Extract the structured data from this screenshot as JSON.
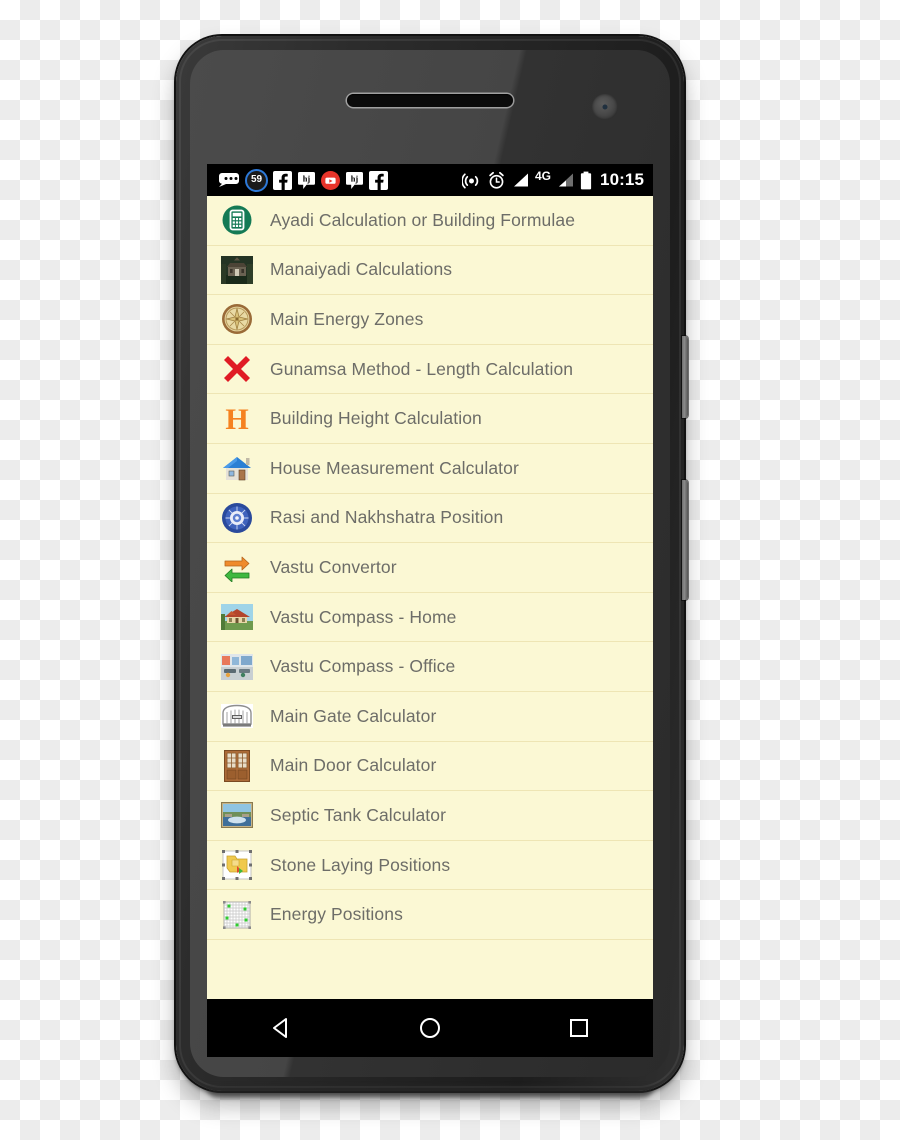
{
  "device": {
    "name": "android-smartphone",
    "earpiece": "earpiece-speaker-grille",
    "bottom_speaker": "bottom-speaker-grille",
    "front_camera": "front-camera",
    "buttons": [
      "volume-rocker",
      "power-button"
    ]
  },
  "status_bar": {
    "background": "#000000",
    "time": "10:15",
    "notification_badge": "59",
    "left_icons": [
      {
        "name": "messages-icon",
        "label": "Messages"
      },
      {
        "name": "notification-count-badge",
        "label": "59"
      },
      {
        "name": "facebook-icon",
        "label": "Facebook"
      },
      {
        "name": "hike-icon",
        "label": "Hike"
      },
      {
        "name": "youtube-icon",
        "label": "YouTube"
      },
      {
        "name": "hike-icon-2",
        "label": "Hike"
      },
      {
        "name": "facebook-icon-2",
        "label": "Facebook"
      }
    ],
    "right_icons": [
      {
        "name": "hotspot-icon",
        "label": "Hotspot"
      },
      {
        "name": "alarm-icon",
        "label": "Alarm"
      },
      {
        "name": "signal-bars-icon",
        "label": "Signal SIM 1"
      },
      {
        "name": "network-type-label",
        "label": "4G"
      },
      {
        "name": "signal-bars-icon-2",
        "label": "Signal SIM 2"
      },
      {
        "name": "battery-icon",
        "label": "Battery"
      }
    ]
  },
  "screen": {
    "background": "#fbf8d4",
    "text_color": "#6d6d68",
    "divider_color": "#eee5b4"
  },
  "app_list": {
    "items": [
      {
        "label": "Ayadi Calculation or Building Formulae",
        "icon": "calculator-icon"
      },
      {
        "label": "Manaiyadi Calculations",
        "icon": "temple-building-icon"
      },
      {
        "label": "Main Energy Zones",
        "icon": "compass-icon"
      },
      {
        "label": "Gunamsa Method - Length Calculation",
        "icon": "red-cross-icon"
      },
      {
        "label": "Building Height Calculation",
        "icon": "letter-h-icon"
      },
      {
        "label": "House Measurement Calculator",
        "icon": "house-icon"
      },
      {
        "label": "Rasi and Nakhshatra Position",
        "icon": "zodiac-chakra-icon"
      },
      {
        "label": "Vastu Convertor",
        "icon": "convert-arrows-icon"
      },
      {
        "label": "Vastu Compass - Home",
        "icon": "home-photo-icon"
      },
      {
        "label": "Vastu Compass - Office",
        "icon": "office-photo-icon"
      },
      {
        "label": "Main Gate Calculator",
        "icon": "gate-icon"
      },
      {
        "label": "Main Door Calculator",
        "icon": "door-icon"
      },
      {
        "label": "Septic Tank Calculator",
        "icon": "septic-tank-icon"
      },
      {
        "label": "Stone Laying Positions",
        "icon": "stone-map-icon"
      },
      {
        "label": "Energy Positions",
        "icon": "energy-grid-icon"
      }
    ]
  },
  "nav_bar": {
    "background": "#000000",
    "buttons": [
      {
        "name": "back-button",
        "label": "Back"
      },
      {
        "name": "home-button",
        "label": "Home"
      },
      {
        "name": "recents-button",
        "label": "Recent apps"
      }
    ]
  }
}
